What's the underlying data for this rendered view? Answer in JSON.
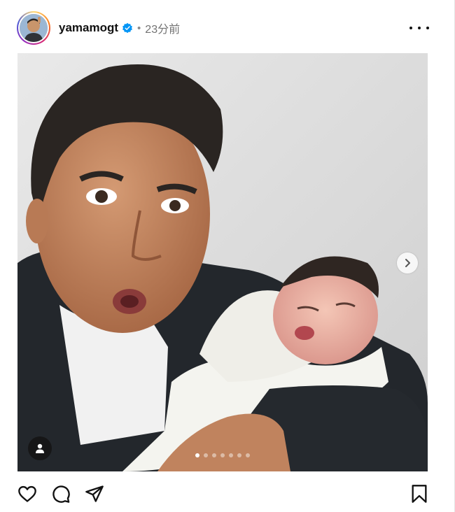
{
  "post": {
    "username": "yamamogt",
    "separator": "•",
    "time_ago": "23分前",
    "slide_count": 7,
    "active_slide": 1
  },
  "icons": {
    "verified": "verified-badge-icon",
    "more": "more-options-icon",
    "next": "chevron-right-icon",
    "tags": "user-tag-icon",
    "like": "heart-icon",
    "comment": "comment-icon",
    "share": "share-icon",
    "save": "bookmark-icon"
  },
  "colors": {
    "verified_blue": "#0095f6",
    "text": "#111111",
    "muted": "#737373"
  }
}
